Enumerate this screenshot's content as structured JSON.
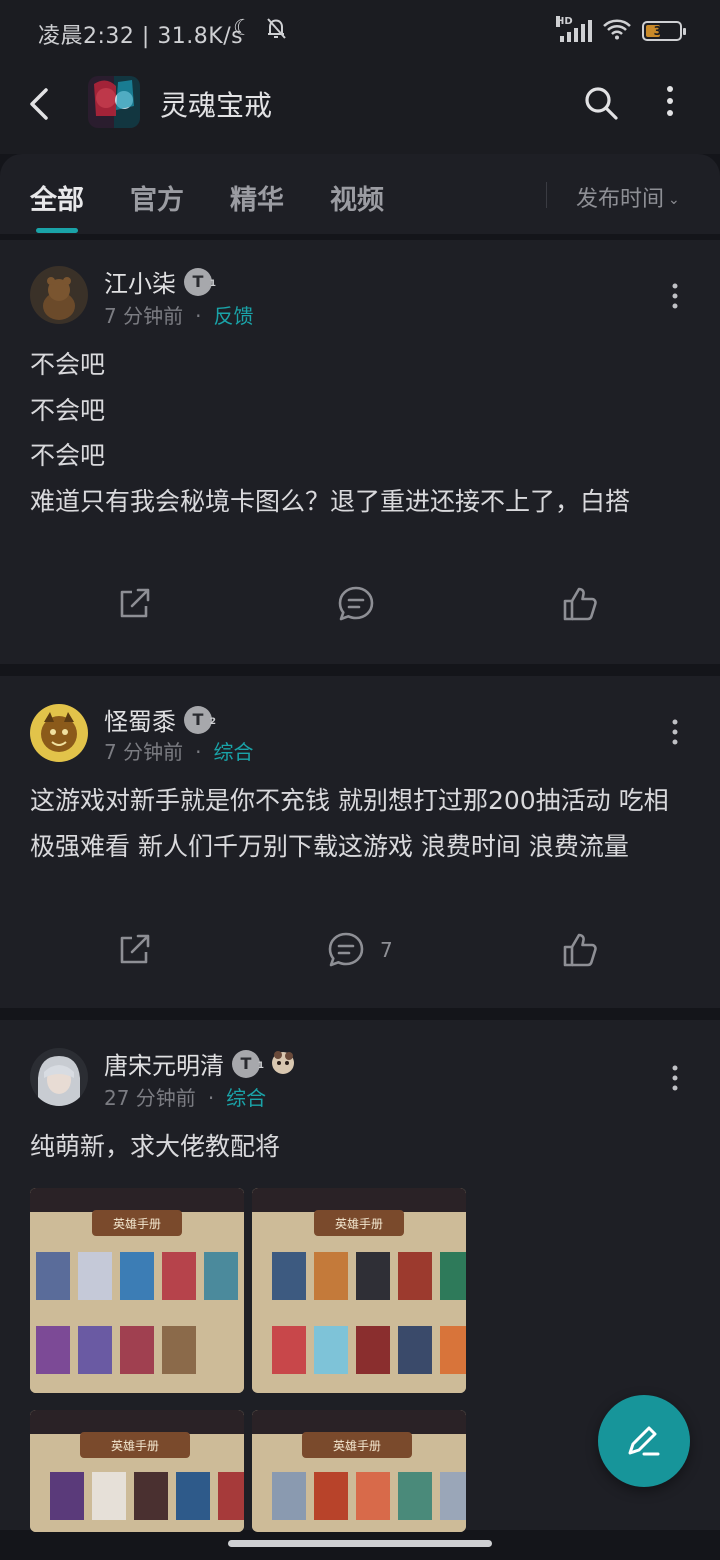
{
  "status_bar": {
    "time": "凌晨2:32",
    "network_speed": "31.8K/s",
    "signal_label": "HD",
    "battery_level": "38"
  },
  "app_bar": {
    "title": "灵魂宝戒"
  },
  "tabs": [
    {
      "label": "全部",
      "active": true
    },
    {
      "label": "官方",
      "active": false
    },
    {
      "label": "精华",
      "active": false
    },
    {
      "label": "视频",
      "active": false
    }
  ],
  "sort": {
    "label": "发布时间"
  },
  "posts": [
    {
      "author": "江小柒",
      "level": "T",
      "level_sub": "1",
      "time_ago": "7 分钟前",
      "category": "反馈",
      "body": "不会吧\n不会吧\n不会吧\n难道只有我会秘境卡图么？退了重进还接不上了，白搭",
      "comments": ""
    },
    {
      "author": "怪蜀黍",
      "level": "T",
      "level_sub": "2",
      "time_ago": "7 分钟前",
      "category": "综合",
      "body": "这游戏对新手就是你不充钱 就别想打过那200抽活动 吃相极强难看 新人们千万别下载这游戏 浪费时间 浪费流量",
      "comments": "7"
    },
    {
      "author": "唐宋元明清",
      "level": "T",
      "level_sub": "1",
      "time_ago": "27 分钟前",
      "category": "综合",
      "body": "纯萌新，求大佬教配将",
      "comments": ""
    }
  ],
  "thumbnail_label": "英雄手册",
  "colors": {
    "accent": "#1aa3a8",
    "background": "#14151a",
    "card": "#1e1f25"
  }
}
